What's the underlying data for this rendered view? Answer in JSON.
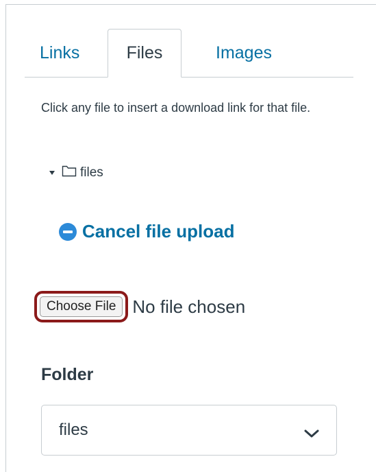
{
  "tabs": [
    {
      "label": "Links",
      "active": false
    },
    {
      "label": "Files",
      "active": true
    },
    {
      "label": "Images",
      "active": false
    }
  ],
  "description": "Click any file to insert a download link for that file.",
  "tree": {
    "folder_label": "files",
    "folder_icon": "folder-icon",
    "expand_icon": "caret-down-icon"
  },
  "cancel_upload": {
    "label": "Cancel file upload",
    "icon": "minus-circle-icon"
  },
  "file_input": {
    "button_label": "Choose File",
    "status": "No file chosen"
  },
  "folder": {
    "label": "Folder",
    "selected": "files",
    "icon": "chevron-down-icon"
  },
  "colors": {
    "link": "#0770a3",
    "text": "#2d3b45",
    "highlight": "#8b1a1a",
    "icon_blue": "#2c8ad8"
  }
}
